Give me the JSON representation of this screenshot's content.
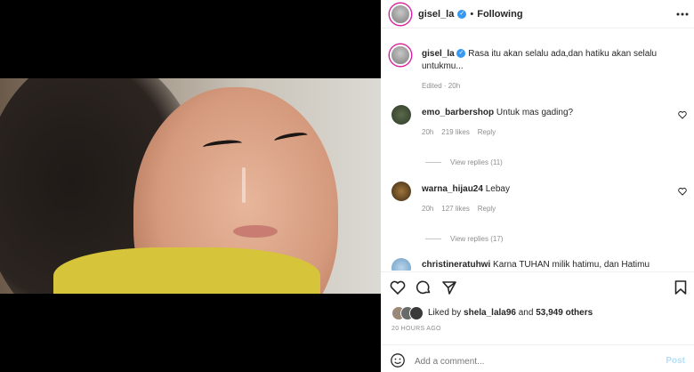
{
  "post": {
    "author": "gisel_la",
    "follow_status": "Following",
    "caption_author": "gisel_la",
    "caption": "Rasa itu akan selalu ada,dan hatiku akan selalu",
    "caption_cont": "untukmu...",
    "caption_meta": "Edited · 20h"
  },
  "comments": [
    {
      "user": "emo_barbershop",
      "text": "Untuk mas gading?",
      "time": "20h",
      "likes": "219 likes",
      "reply": "Reply",
      "view_replies": "View replies (11)"
    },
    {
      "user": "warna_hijau24",
      "text": "Lebay",
      "time": "20h",
      "likes": "127 likes",
      "reply": "Reply",
      "view_replies": "View replies (17)"
    },
    {
      "user": "christineratuhwi",
      "text": "Karna TUHAN milik hatimu, dan Hatimu"
    }
  ],
  "likes": {
    "prefix": "Liked by",
    "user": "shela_lala96",
    "and": "and",
    "others": "53,949 others",
    "timestamp": "20 HOURS AGO"
  },
  "composer": {
    "placeholder": "Add a comment...",
    "post_label": "Post"
  },
  "icons": {
    "more": "more-icon",
    "heart": "heart-icon",
    "comment": "comment-icon",
    "share": "share-icon",
    "save": "bookmark-icon",
    "emoji": "emoji-icon"
  },
  "colors": {
    "verified": "#3897f0",
    "post_button": "#b2dffc",
    "link": "#00376b"
  }
}
